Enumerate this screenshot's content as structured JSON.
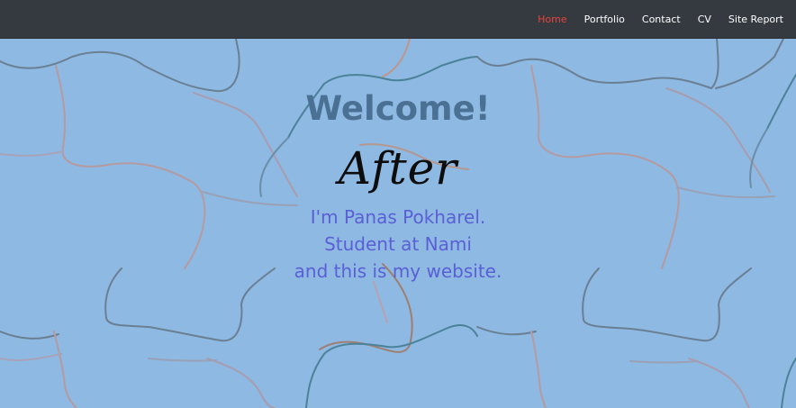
{
  "navbar": {
    "links": [
      {
        "label": "Home",
        "active": true
      },
      {
        "label": "Portfolio",
        "active": false
      },
      {
        "label": "Contact",
        "active": false
      },
      {
        "label": "CV",
        "active": false
      },
      {
        "label": "Site Report",
        "active": false
      }
    ]
  },
  "hero": {
    "heading": "Welcome!",
    "subheading": "After",
    "intro_lines": [
      "I'm Panas Pokharel.",
      "Student at Nami",
      "and this is my website."
    ]
  },
  "colors": {
    "navbar_bg": "#343a40",
    "page_bg": "#8db9e2",
    "active_link": "#e8433b",
    "heading": "#4a7194",
    "intro_text": "#5b5fd6"
  }
}
